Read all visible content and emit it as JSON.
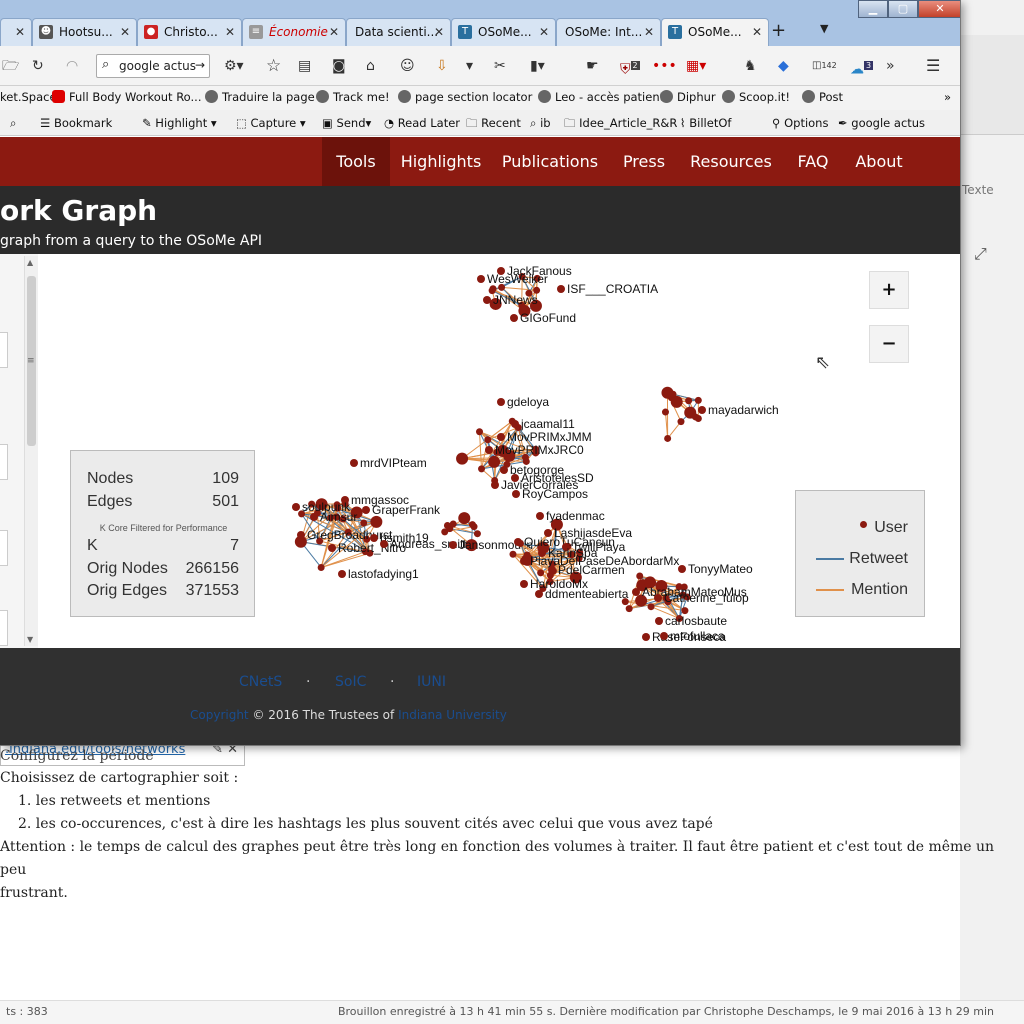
{
  "browser": {
    "tabs": [
      {
        "label": "Hootsu...",
        "left": 0
      },
      {
        "label": "Christo...",
        "left": 0
      },
      {
        "label": "Économie",
        "left": 0
      },
      {
        "label": "Data scienti...",
        "left": 0
      },
      {
        "label": "OSoMe...",
        "left": 0
      },
      {
        "label": "OSoMe: Int...",
        "left": 0
      },
      {
        "label": "OSoMe...",
        "left": 0
      }
    ],
    "search_text": "google actus",
    "badges": {
      "ublock": "2",
      "ext1": "142",
      "ext2": "3"
    },
    "bookmarks": [
      "ket.Space",
      "Full Body Workout Ro...",
      "Traduire la page",
      "Track me!",
      "page section locator",
      "Leo - accès patient",
      "Diphur",
      "Scoop.it!",
      "Post"
    ],
    "toolbar2": [
      "Bookmark",
      "Highlight",
      "Capture",
      "Send",
      "Read Later",
      "Recent",
      "ib",
      "Idee_Article_R&R",
      "BilletOf",
      "Options",
      "google  actus"
    ]
  },
  "site": {
    "nav": [
      "Tools",
      "Highlights",
      "Publications",
      "Press",
      "Resources",
      "FAQ",
      "About"
    ],
    "active_nav": "Tools",
    "title": "ork Graph",
    "subtitle": "graph from a query to the OSoMe API"
  },
  "zoom": {
    "plus": "+",
    "minus": "−"
  },
  "stats": {
    "nodes_label": "Nodes",
    "nodes": "109",
    "edges_label": "Edges",
    "edges": "501",
    "note": "K Core Filtered for Performance",
    "k_label": "K",
    "k": "7",
    "orig_nodes_label": "Orig Nodes",
    "orig_nodes": "266156",
    "orig_edges_label": "Orig Edges",
    "orig_edges": "371553"
  },
  "legend": {
    "user": "User",
    "retweet": "Retweet",
    "mention": "Mention"
  },
  "colors": {
    "node": "#8b1a10",
    "retweet": "#4a7aa3",
    "mention": "#e0904a",
    "nav": "#8c1a11"
  },
  "graph_labels": [
    "JackFanous",
    "WesWelker",
    "ISF___CROATIA",
    "JNNews",
    "GIGoFund",
    "gdeloya",
    "jcaamal11",
    "MovPRIMxJMM",
    "MovPRIMxJRC0",
    "betogorge",
    "AristotelesSD",
    "JavierCorrales",
    "RoyCampos",
    "mayadarwich",
    "mrdVIPteam",
    "mmgassoc",
    "soulpunk",
    "GraperFrank",
    "Aimsur",
    "GregBroadhurst",
    "Robert_Nitro",
    "bsmith19",
    "Andreas_smith",
    "lastofadying1",
    "Jansonmoulin",
    "fyadenmac",
    "LashijasdeEva",
    "QuieroTuCancun",
    "TwillPlaya",
    "KarinSpa",
    "PlayaDelPaseDeAbordarMx",
    "PdelCarmen",
    "HaroldoMx",
    "ddmenteabierta",
    "AbrahamMateoMus",
    "TonyyMateo",
    "Catherine_fulop",
    "carlosbaute",
    "RaseFonseca",
    "mtofullaca"
  ],
  "footer": {
    "links": [
      "CNetS",
      "SoIC",
      "IUNI"
    ],
    "copy_prefix": "Copyright",
    "copy_text": "© 2016 The Trustees of",
    "copy_link": "Indiana University"
  },
  "background_page": {
    "url_fragment": ".indiana.edu/tools/networks",
    "texte_tab": "Texte",
    "line0": "Configurez la période",
    "line1": "Choisissez de cartographier soit :",
    "item1": "1. les retweets et mentions",
    "item2": "2. les co-occurences, c'est à dire les hashtags les plus souvent cités avec celui que vous avez tapé",
    "line2": "Attention : le temps de calcul des graphes peut être très long en fonction des volumes à traiter. Il faut être patient et c'est tout de même un peu",
    "line3": "frustrant.",
    "status_left": "ts : 383",
    "status_right": "Brouillon enregistré à 13 h 41 min 55 s. Dernière modification par Christophe Deschamps, le 9 mai 2016 à 13 h 29 min"
  }
}
